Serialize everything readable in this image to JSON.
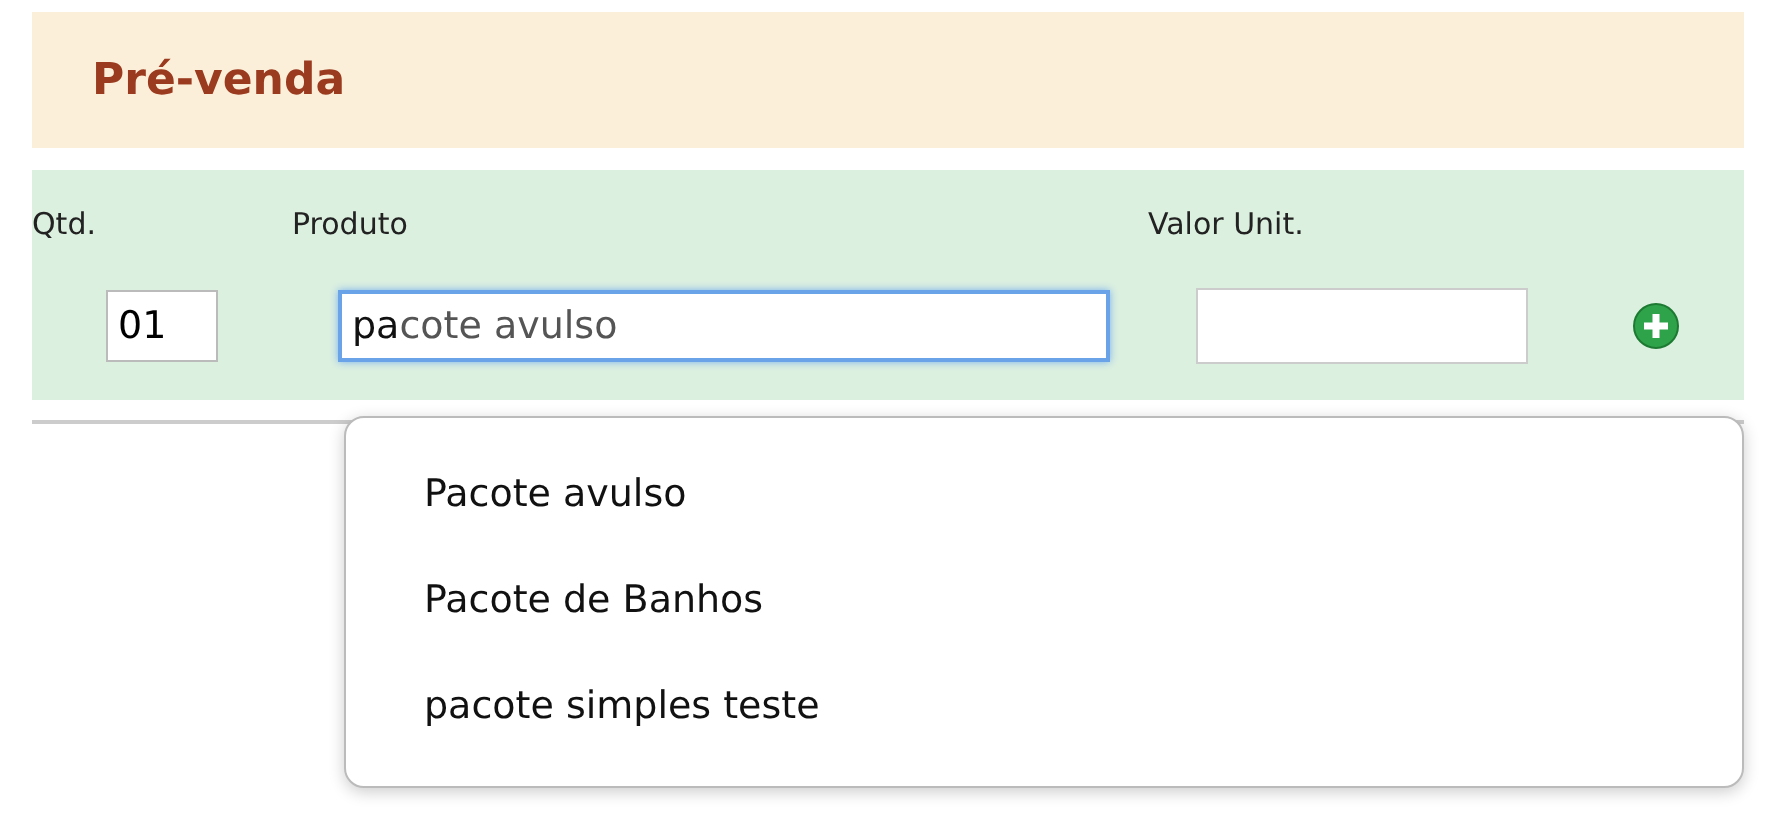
{
  "header": {
    "title": "Pré-venda"
  },
  "form": {
    "columns": [
      "Qtd.",
      "Produto",
      "Valor Unit."
    ],
    "quantity": {
      "value": "01"
    },
    "product": {
      "typed": "pa",
      "completion": "cote avulso",
      "focused": true
    }
  },
  "suggestions": [
    {
      "label": "Pacote avulso"
    },
    {
      "label": "Pacote de Banhos"
    },
    {
      "label": "pacote simples teste"
    }
  ]
}
